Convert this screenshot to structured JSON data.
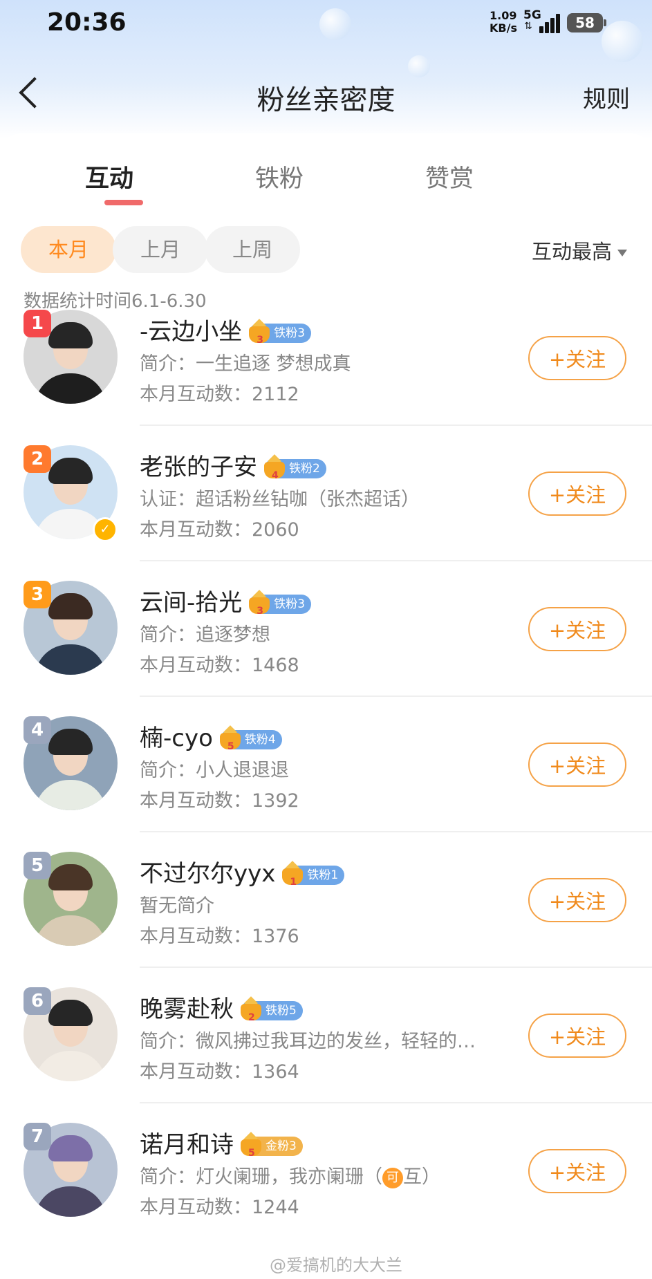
{
  "status_bar": {
    "time": "20:36",
    "net_speed": "1.09",
    "net_unit": "KB/s",
    "network": "5G",
    "battery": "58"
  },
  "nav": {
    "title": "粉丝亲密度",
    "rules": "规则"
  },
  "tabs": [
    {
      "label": "互动",
      "active": true
    },
    {
      "label": "铁粉",
      "active": false
    },
    {
      "label": "赞赏",
      "active": false
    }
  ],
  "filters": [
    {
      "label": "本月",
      "active": true
    },
    {
      "label": "上月",
      "active": false
    },
    {
      "label": "上周",
      "active": false
    }
  ],
  "sort_label": "互动最高",
  "stat_period": "数据统计时间6.1-6.30",
  "follow_label": "+关注",
  "rank_colors": [
    "#f5484b",
    "#ff7a2e",
    "#ff9b1a",
    "#9aa6bd",
    "#9aa6bd",
    "#9aa6bd",
    "#9aa6bd"
  ],
  "fans": [
    {
      "rank": "1",
      "name": "-云边小坐",
      "crown_level": "3",
      "badge": "铁粉3",
      "badge_type": "iron",
      "desc": "简介：一生追逐 梦想成真",
      "count": "本月互动数：2112"
    },
    {
      "rank": "2",
      "name": "老张的子安",
      "crown_level": "4",
      "badge": "铁粉2",
      "badge_type": "iron",
      "desc": "认证：超话粉丝钻咖（张杰超话）",
      "count": "本月互动数：2060",
      "verified": true
    },
    {
      "rank": "3",
      "name": "云间-拾光",
      "crown_level": "3",
      "badge": "铁粉3",
      "badge_type": "iron",
      "desc": "简介：追逐梦想",
      "count": "本月互动数：1468"
    },
    {
      "rank": "4",
      "name": "楠-cyo",
      "crown_level": "5",
      "badge": "铁粉4",
      "badge_type": "iron",
      "desc": "简介：小人退退退",
      "count": "本月互动数：1392"
    },
    {
      "rank": "5",
      "name": "不过尔尔yyx",
      "crown_level": "1",
      "badge": "铁粉1",
      "badge_type": "iron",
      "desc": "暂无简介",
      "count": "本月互动数：1376"
    },
    {
      "rank": "6",
      "name": "晚雾赴秋",
      "crown_level": "2",
      "badge": "铁粉5",
      "badge_type": "iron",
      "desc": "简介：微风拂过我耳边的发丝，轻轻的…",
      "count": "本月互动数：1364"
    },
    {
      "rank": "7",
      "name": "诺月和诗",
      "crown_level": "5",
      "badge": "金粉3",
      "badge_type": "gold",
      "desc_prefix": "简介：灯火阑珊，我亦阑珊（",
      "desc_icon": "可",
      "desc_suffix": "互）",
      "count": "本月互动数：1244"
    }
  ],
  "watermark": "@爱搞机的大大兰",
  "colors": {
    "accent": "#ff8a1f",
    "tab_indicator": "#f06a6a",
    "iron_badge": "#6ea6e8",
    "gold_badge": "#f2b34b"
  }
}
